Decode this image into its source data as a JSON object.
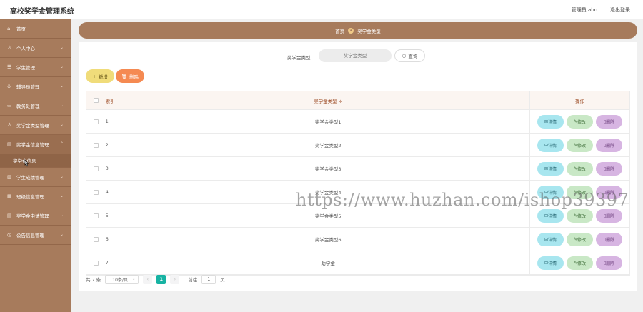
{
  "app": {
    "title": "高校奖学金管理系统",
    "user_label": "管理员 abo",
    "logout_label": "退出登录"
  },
  "sidebar": {
    "items": [
      {
        "label": "首页",
        "icon": "home-icon",
        "glyph": "⌂"
      },
      {
        "label": "个人中心",
        "icon": "user-icon",
        "glyph": "♙"
      },
      {
        "label": "学生管理",
        "icon": "list-icon",
        "glyph": "☰"
      },
      {
        "label": "辅导员管理",
        "icon": "pin-icon",
        "glyph": "♁"
      },
      {
        "label": "教务处管理",
        "icon": "folder-icon",
        "glyph": "▭"
      },
      {
        "label": "奖学金类型管理",
        "icon": "user-icon",
        "glyph": "♙"
      },
      {
        "label": "奖学金信息管理",
        "icon": "doc-icon",
        "glyph": "▤"
      },
      {
        "label": "学生成绩管理",
        "icon": "chart-icon",
        "glyph": "▥"
      },
      {
        "label": "班级信息管理",
        "icon": "group-icon",
        "glyph": "▦"
      },
      {
        "label": "奖学金申请管理",
        "icon": "doc-icon",
        "glyph": "▤"
      },
      {
        "label": "公告信息管理",
        "icon": "bell-icon",
        "glyph": "◷"
      }
    ],
    "sub_item": "奖学金信息"
  },
  "breadcrumb": {
    "home": "首页",
    "current": "奖学金类型"
  },
  "search": {
    "label": "奖学金类型",
    "placeholder": "奖学金类型",
    "button": "查询"
  },
  "toolbar": {
    "add_label": "新增",
    "delete_label": "删除"
  },
  "table": {
    "headers": {
      "index": "索引",
      "type": "奖学金类型 ≑",
      "actions": "操作"
    },
    "rows": [
      {
        "index": "1",
        "type": "奖学金类型1"
      },
      {
        "index": "2",
        "type": "奖学金类型2"
      },
      {
        "index": "3",
        "type": "奖学金类型3"
      },
      {
        "index": "4",
        "type": "奖学金类型4"
      },
      {
        "index": "5",
        "type": "奖学金类型5"
      },
      {
        "index": "6",
        "type": "奖学金类型6"
      },
      {
        "index": "7",
        "type": "助学金"
      }
    ],
    "actions": {
      "detail": "详情",
      "edit": "修改",
      "delete": "删除"
    }
  },
  "pagination": {
    "total": "共 7 条",
    "page_size": "10条/页",
    "current_page": "1",
    "goto_label": "前往",
    "goto_value": "1",
    "page_suffix": "页"
  },
  "watermark": "https://www.huzhan.com/ishop39397"
}
